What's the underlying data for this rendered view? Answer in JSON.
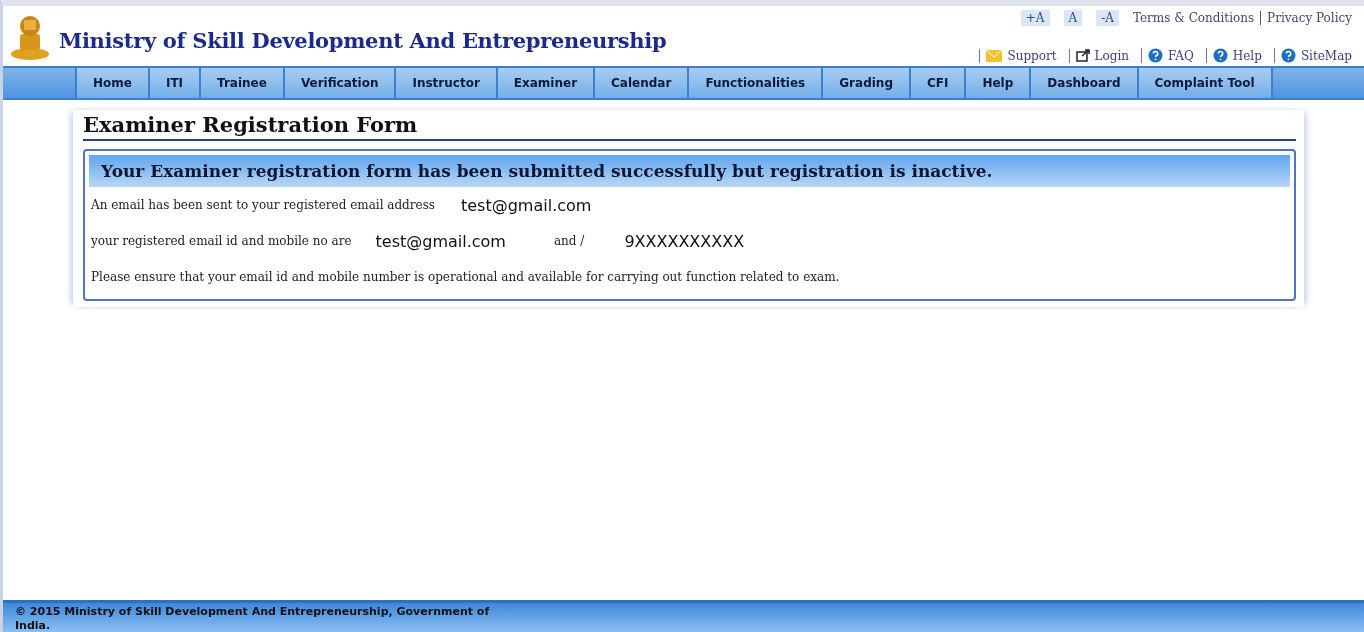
{
  "header": {
    "title": "Ministry of Skill Development And Entrepreneurship",
    "font_sizes": [
      "+A",
      "A",
      "-A"
    ],
    "policy_links": [
      "Terms & Conditions",
      "Privacy Policy"
    ],
    "quick_links": [
      {
        "label": "Support",
        "kind": "mail"
      },
      {
        "label": "Login",
        "kind": "window"
      },
      {
        "label": "FAQ",
        "kind": "help"
      },
      {
        "label": "Help",
        "kind": "help"
      },
      {
        "label": "SiteMap",
        "kind": "help"
      }
    ]
  },
  "nav": [
    "Home",
    "ITI",
    "Trainee",
    "Verification",
    "Instructor",
    "Examiner",
    "Calendar",
    "Functionalities",
    "Grading",
    "CFI",
    "Help",
    "Dashboard",
    "Complaint Tool"
  ],
  "form": {
    "title": "Examiner Registration Form",
    "banner": "Your Examiner registration form has been submitted successfully but registration is inactive.",
    "email_line": {
      "label": "An email has been sent to your registered email address",
      "email": "test@gmail.com"
    },
    "contact_line": {
      "label": "your registered email id and mobile no are",
      "email": "test@gmail.com",
      "joiner": "and /",
      "mobile": "9XXXXXXXXXX"
    },
    "note": "Please ensure that your email id and mobile number is operational and available for carrying out function related to exam."
  },
  "footer": [
    "© 2015 Ministry of Skill Development And Entrepreneurship, Government of",
    "India."
  ]
}
